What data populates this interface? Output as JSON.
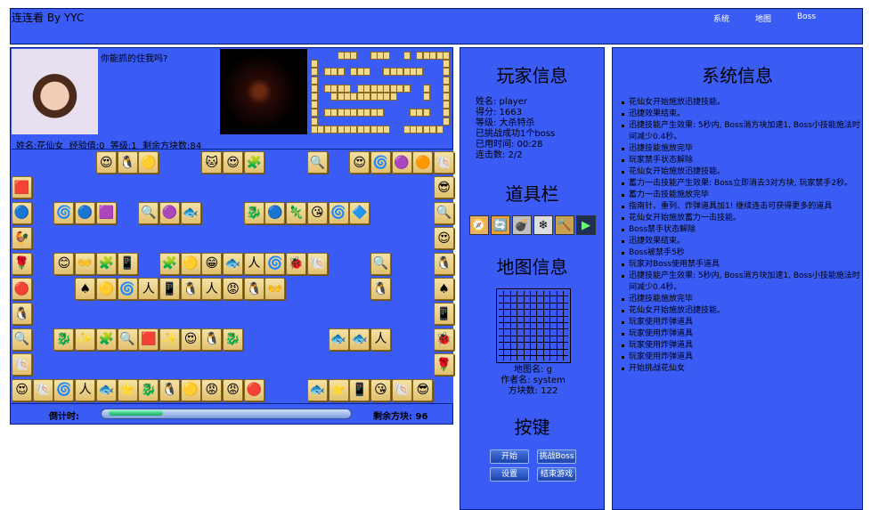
{
  "app": {
    "title": "连连看 By YYC"
  },
  "menu": [
    "系统",
    "地图",
    "Boss"
  ],
  "speech": "你能抓的住我吗?",
  "player_bar": {
    "name_label": "姓名:",
    "name": "花仙女",
    "exp_label": "经验值:",
    "exp": "0",
    "level_label": "等级:",
    "level": "1",
    "remain_label": "剩余方块数:",
    "remain": "84"
  },
  "timer": {
    "label": "倒计时:",
    "progress": 0.23
  },
  "remain_bottom": {
    "label": "剩余方块:",
    "value": "96"
  },
  "player_info": {
    "title": "玩家信息",
    "lines": [
      "姓名: player",
      "得分: 1663",
      "等级: 大杀特杀",
      "已挑战成功1个boss",
      "已用时间: 00:28",
      "连击数: 2/2"
    ]
  },
  "tools": {
    "title": "道具栏",
    "items": [
      "compass-icon",
      "refresh-icon",
      "bomb-icon",
      "freeze-icon",
      "hammer-icon",
      "double-arrow-icon"
    ]
  },
  "map_info": {
    "title": "地图信息",
    "lines": [
      "地图名: g",
      "作者名: system",
      "方块数: 122"
    ]
  },
  "buttons": {
    "title": "按键",
    "start": "开始",
    "challenge": "挑战Boss",
    "settings": "设置",
    "end": "结束游戏"
  },
  "system_info": {
    "title": "系统信息",
    "log": [
      "花仙女开始施放迅捷技能。",
      "迅捷效果结束。",
      "迅捷技能产生效果: 5秒内, Boss消方块加速1, Boss小技能施法时间减少0.4秒。",
      "迅捷技能施放完毕",
      "玩家禁手状态解除",
      "花仙女开始施放迅捷技能。",
      "蓄力一击技能产生效果: Boss立即消去3对方块, 玩家禁手2秒。",
      "蓄力一击技能施放完毕",
      "指南针、重列、炸弹道具加1! 继续连击可获得更多的道具",
      "花仙女开始施放蓄力一击技能。",
      "Boss禁手状态解除",
      "迅捷效果结束。",
      "Boss被禁手5秒",
      "玩家对Boss使用禁手道具",
      "迅捷技能产生效果: 5秒内, Boss消方块加速1, Boss小技能施法时间减少0.4秒。",
      "迅捷技能施放完毕",
      "花仙女开始施放迅捷技能。",
      "玩家使用炸弹道具",
      "玩家使用炸弹道具",
      "玩家使用炸弹道具",
      "玩家使用炸弹道具",
      "开始挑战花仙女"
    ]
  },
  "colors": {
    "panel": "#3a5cf5",
    "tile": "#f4e3a6",
    "accent": "#15a560"
  },
  "board": {
    "rows": [
      [
        null,
        null,
        null,
        null,
        "😍",
        "🐧",
        "🟡",
        null,
        null,
        "🐱",
        "😍",
        "🧩",
        null,
        null,
        "🔍",
        null,
        "😍",
        "🌀",
        "🟣",
        "🟠",
        "🐚"
      ],
      [
        "🟥",
        null,
        null,
        null,
        null,
        null,
        null,
        null,
        null,
        null,
        null,
        null,
        null,
        null,
        null,
        null,
        null,
        null,
        null,
        null,
        "😎"
      ],
      [
        "🔵",
        null,
        "🌀",
        "🔵",
        "🟪",
        null,
        "🔍",
        "🟣",
        "🐟",
        null,
        null,
        "🐉",
        "🔵",
        "🦎",
        "😘",
        "🌀",
        "🔷",
        null,
        null,
        null,
        "🔍"
      ],
      [
        "🐓",
        null,
        null,
        null,
        null,
        null,
        null,
        null,
        null,
        null,
        null,
        null,
        null,
        null,
        null,
        null,
        null,
        null,
        null,
        null,
        "😍"
      ],
      [
        "🌹",
        null,
        "😊",
        "👐",
        "🧩",
        "📱",
        null,
        "🧩",
        "🟡",
        "😁",
        "🐟",
        "人",
        "🌀",
        "🐞",
        "🐚",
        null,
        null,
        "🔍",
        null,
        null,
        "🐧"
      ],
      [
        "🔴",
        null,
        null,
        "♠",
        "🟡",
        "🌀",
        "人",
        "📱",
        "🐧",
        "人",
        "😡",
        "🐧",
        "👐",
        null,
        null,
        null,
        null,
        "🐧",
        null,
        null,
        "♠"
      ],
      [
        "🐧",
        null,
        null,
        null,
        null,
        null,
        null,
        null,
        null,
        null,
        null,
        null,
        null,
        null,
        null,
        null,
        null,
        null,
        null,
        null,
        "📱"
      ],
      [
        "🔍",
        null,
        "🐉",
        "✨",
        "🧩",
        "🔍",
        "🟥",
        "✨",
        "😍",
        "🐧",
        "🐉",
        null,
        null,
        null,
        null,
        "🐟",
        "🐟",
        "人",
        null,
        null,
        "🐞"
      ],
      [
        "🐚",
        null,
        null,
        null,
        null,
        null,
        null,
        null,
        null,
        null,
        null,
        null,
        null,
        null,
        null,
        null,
        null,
        null,
        null,
        null,
        "🌹"
      ],
      [
        "😍",
        "🐚",
        "🌀",
        "人",
        "🐟",
        "⭐",
        "🐉",
        "🐧",
        "🟡",
        "😡",
        "😡",
        "🔴",
        null,
        null,
        "🐟",
        "⭐",
        "📱",
        "😘",
        "🐚",
        "😎",
        null
      ]
    ]
  }
}
